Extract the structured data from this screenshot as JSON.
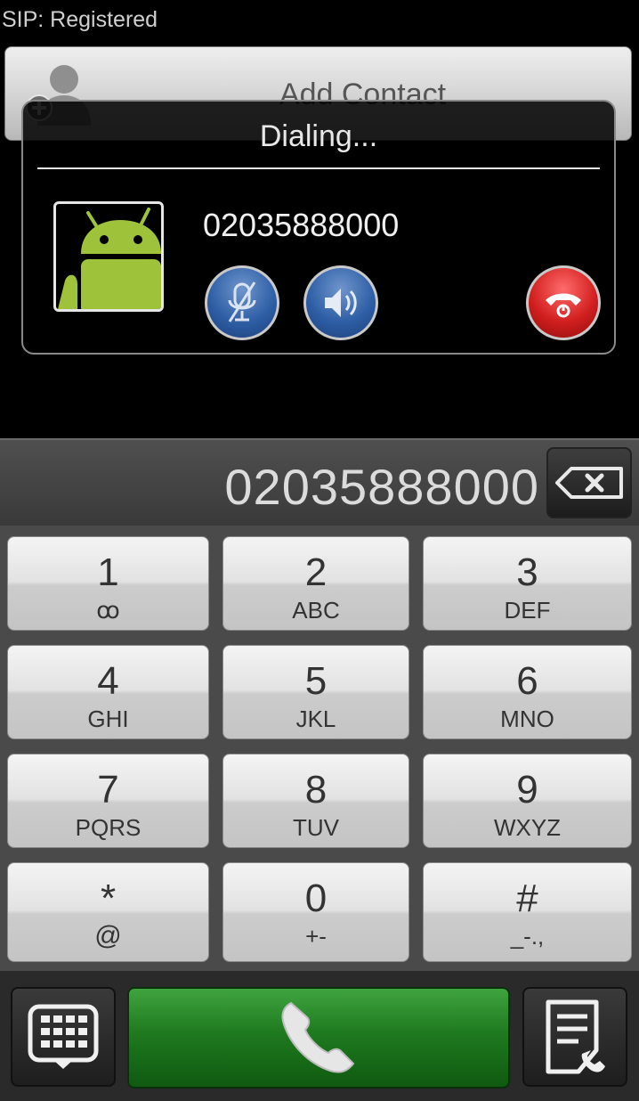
{
  "status": {
    "sip": "SIP: Registered"
  },
  "add_contact": {
    "label": "Add Contact",
    "icon": "add-contact-icon"
  },
  "dialog": {
    "title": "Dialing...",
    "number": "02035888000",
    "avatar_icon": "android-robot-icon",
    "mute_icon": "mute-mic-icon",
    "speaker_icon": "speaker-icon",
    "hangup_icon": "hangup-icon",
    "colors": {
      "mute_speaker": "#2f5fa6",
      "hangup": "#d21f1f"
    }
  },
  "entry": {
    "number": "02035888000",
    "backspace_icon": "backspace-icon"
  },
  "keypad": {
    "keys": [
      {
        "digit": "1",
        "letters": "ꝏ"
      },
      {
        "digit": "2",
        "letters": "ABC"
      },
      {
        "digit": "3",
        "letters": "DEF"
      },
      {
        "digit": "4",
        "letters": "GHI"
      },
      {
        "digit": "5",
        "letters": "JKL"
      },
      {
        "digit": "6",
        "letters": "MNO"
      },
      {
        "digit": "7",
        "letters": "PQRS"
      },
      {
        "digit": "8",
        "letters": "TUV"
      },
      {
        "digit": "9",
        "letters": "WXYZ"
      },
      {
        "digit": "*",
        "letters": "@"
      },
      {
        "digit": "0",
        "letters": "+-"
      },
      {
        "digit": "#",
        "letters": "_-.,"
      }
    ]
  },
  "bottom": {
    "keypad_toggle_icon": "dialpad-icon",
    "call_icon": "phone-handset-icon",
    "history_icon": "call-log-icon",
    "call_color": "#1f7a1f"
  }
}
